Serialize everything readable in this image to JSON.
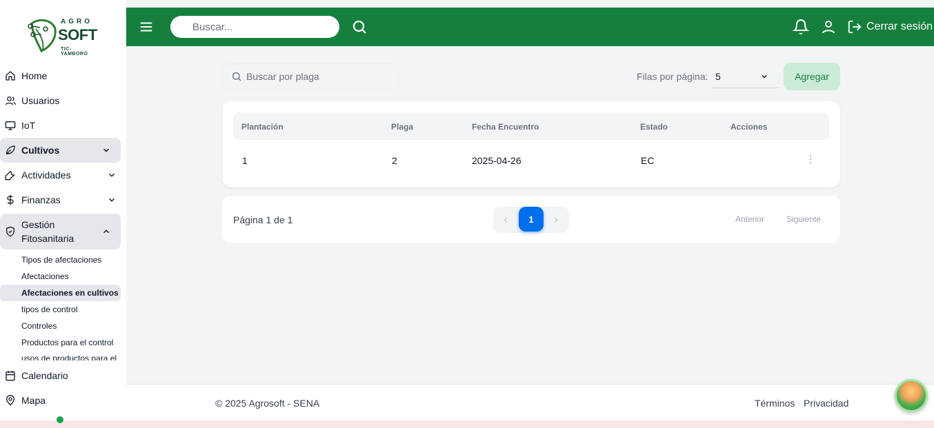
{
  "brand": {
    "top": "AGRO",
    "main": "SOFT",
    "sub": "TIC-YAMBORÓ"
  },
  "sidebar": {
    "items": [
      {
        "label": "Home",
        "icon": "home-icon"
      },
      {
        "label": "Usuarios",
        "icon": "users-icon"
      },
      {
        "label": "IoT",
        "icon": "monitor-icon"
      },
      {
        "label": "Cultivos",
        "icon": "leaf-icon",
        "expandable": true,
        "active": true
      },
      {
        "label": "Actividades",
        "icon": "wrench-icon",
        "expandable": true
      },
      {
        "label": "Finanzas",
        "icon": "dollar-icon",
        "expandable": true
      },
      {
        "label": "Gestión Fitosanitaria",
        "icon": "shield-icon",
        "expandable": true,
        "expanded": true
      }
    ],
    "submenu": [
      "Tipos de afectaciones",
      "Afectaciones",
      "Afectaciones en cultivos",
      "tipos de control",
      "Controles",
      "Productos para el control",
      "usos de productos para el"
    ],
    "submenu_active": "Afectaciones en cultivos",
    "bottom_items": [
      {
        "label": "Calendario",
        "icon": "calendar-icon"
      },
      {
        "label": "Mapa",
        "icon": "map-pin-icon"
      }
    ]
  },
  "topbar": {
    "search_placeholder": "Buscar...",
    "logout_label": "Cerrar sesión",
    "color": "#15803d"
  },
  "filters": {
    "search_placeholder": "Buscar por plaga",
    "rows_label": "Filas por página:",
    "rows_value": "5",
    "add_label": "Agregar"
  },
  "table": {
    "columns": [
      "Plantación",
      "Plaga",
      "Fecha Encuentro",
      "Estado",
      "Acciones"
    ],
    "rows": [
      {
        "plantacion": "1",
        "plaga": "2",
        "fecha": "2025-04-26",
        "estado": "EC"
      }
    ]
  },
  "pagination": {
    "summary": "Página 1 de 1",
    "current": "1",
    "prev_label": "Anterior",
    "next_label": "Siguiente",
    "accent": "#006fee"
  },
  "footer": {
    "copyright": "© 2025 Agrosoft - SENA",
    "terms": "Términos",
    "privacy": "Privacidad"
  }
}
